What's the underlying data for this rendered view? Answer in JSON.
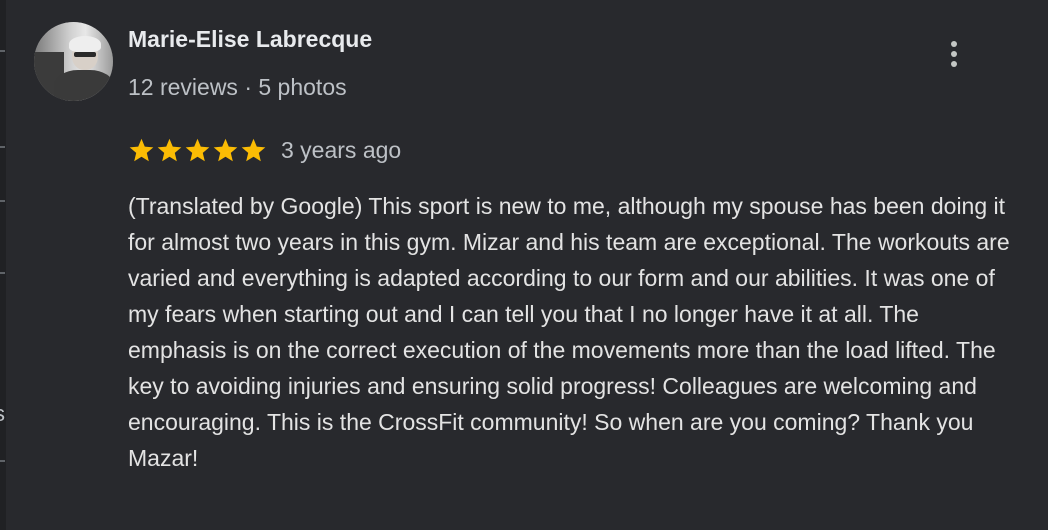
{
  "review": {
    "reviewer_name": "Marie-Elise Labrecque",
    "reviewer_meta": "12 reviews · 5 photos",
    "rating": 5,
    "rating_max": 5,
    "date": "3 years ago",
    "text": "(Translated by Google) This sport is new to me, although my spouse has been doing it for almost two years in this gym. Mizar and his team are exceptional. The workouts are varied and everything is adapted according to our form and our abilities. It was one of my fears when starting out and I can tell you that I no longer have it at all. The emphasis is on the correct execution of the movements more than the load lifted. The key to avoiding injuries and ensuring solid progress! Colleagues are welcoming and encouraging. This is the CrossFit community! So when are you coming? Thank you Mazar!"
  },
  "edge": {
    "glyph": "s"
  },
  "icons": {
    "more": "more-vert-icon",
    "star": "star-icon"
  },
  "colors": {
    "background": "#28292d",
    "star": "#fbbc04",
    "name": "#e8eaed",
    "secondary_text": "#bdc1c6"
  }
}
